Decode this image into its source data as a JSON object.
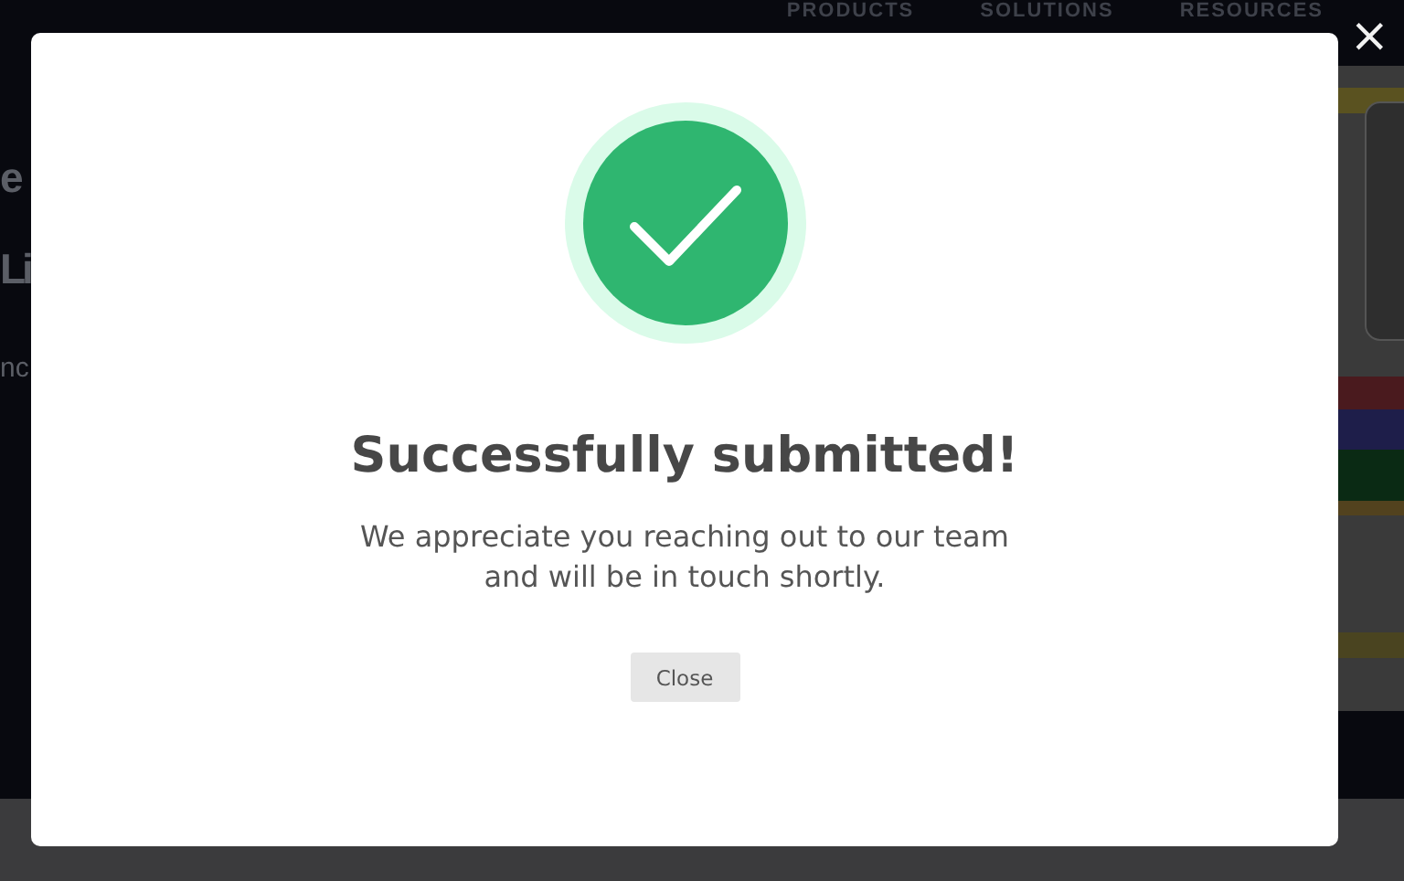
{
  "background_page": {
    "nav": [
      "PRODUCTS",
      "SOLUTIONS",
      "RESOURCES"
    ],
    "hero_fragments": [
      {
        "kind": "heading",
        "text": "e"
      },
      {
        "kind": "heading",
        "text": "Li"
      },
      {
        "kind": "body",
        "text": "nc"
      }
    ]
  },
  "dialog": {
    "close_icon": "×",
    "title": "Successfully submitted!",
    "message_lines": [
      "We appreciate you reaching out to our team",
      "and will be in touch shortly."
    ],
    "button": "Close"
  }
}
